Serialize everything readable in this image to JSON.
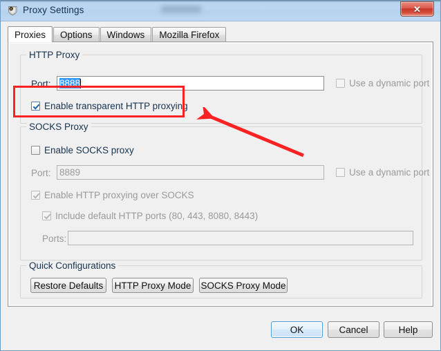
{
  "window": {
    "title": "Proxy Settings",
    "icon": "fiddler-shield-icon",
    "close_label": "✕",
    "accent_blue": "#3399ff",
    "annotation_color": "#fa2222"
  },
  "tabs": [
    {
      "label": "Proxies",
      "active": true
    },
    {
      "label": "Options",
      "active": false
    },
    {
      "label": "Windows",
      "active": false
    },
    {
      "label": "Mozilla Firefox",
      "active": false
    }
  ],
  "http_proxy": {
    "group_title": "HTTP Proxy",
    "port_label": "Port:",
    "port_value": "8888",
    "port_selected": true,
    "dynamic_port_label": "Use a dynamic port",
    "dynamic_port_checked": false,
    "dynamic_port_enabled": false,
    "transparent_label": "Enable transparent HTTP proxying",
    "transparent_checked": true
  },
  "socks_proxy": {
    "group_title": "SOCKS Proxy",
    "enable_label": "Enable SOCKS proxy",
    "enable_checked": false,
    "port_label": "Port:",
    "port_value": "8889",
    "port_enabled": false,
    "dynamic_port_label": "Use a dynamic port",
    "dynamic_port_checked": false,
    "dynamic_port_enabled": false,
    "http_over_socks_label": "Enable HTTP proxying over SOCKS",
    "http_over_socks_checked": true,
    "http_over_socks_enabled": false,
    "default_ports_label": "Include default HTTP ports (80, 443, 8080, 8443)",
    "default_ports_checked": true,
    "default_ports_enabled": false,
    "ports_label": "Ports:",
    "ports_value": "",
    "ports_enabled": false
  },
  "quick_configurations": {
    "group_title": "Quick Configurations",
    "buttons": [
      {
        "label": "Restore Defaults"
      },
      {
        "label": "HTTP Proxy Mode"
      },
      {
        "label": "SOCKS Proxy Mode"
      }
    ]
  },
  "dialog_buttons": [
    {
      "label": "OK",
      "default": true
    },
    {
      "label": "Cancel",
      "default": false
    },
    {
      "label": "Help",
      "default": false
    }
  ]
}
